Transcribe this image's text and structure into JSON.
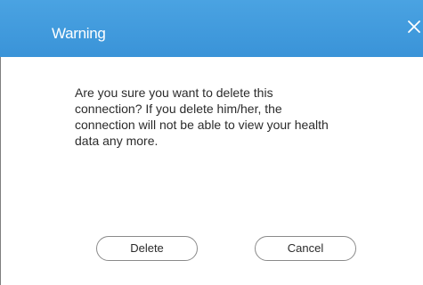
{
  "dialog": {
    "title": "Warning",
    "message": "Are you sure you want to delete this connection? If you delete him/her, the connection will not be able to view your health data any more.",
    "buttons": {
      "delete_label": "Delete",
      "cancel_label": "Cancel"
    },
    "close_icon": "close-icon"
  },
  "colors": {
    "titlebar": "#3d97dc",
    "title_text": "#ffffff",
    "button_border": "#8a8a8a",
    "body_text": "#2b2b2b"
  }
}
